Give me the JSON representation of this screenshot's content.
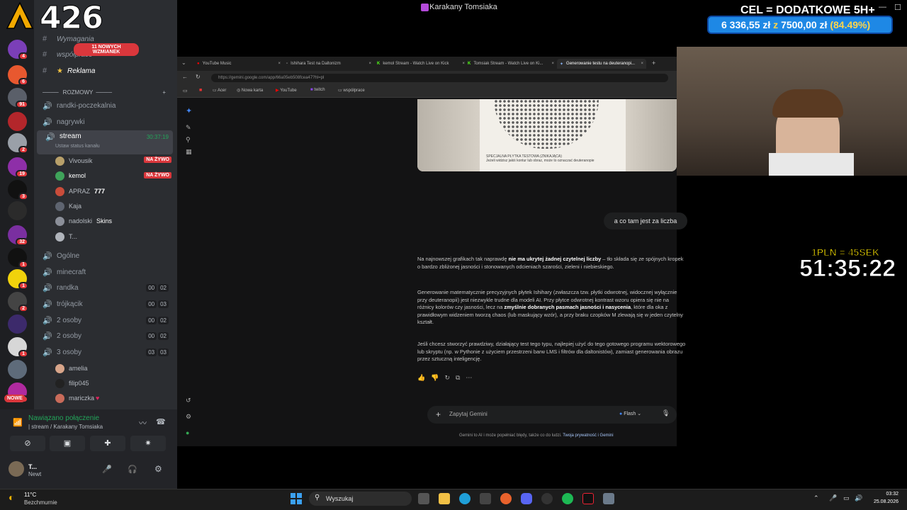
{
  "window": {
    "title": "Karakany Tomsiaka"
  },
  "overlay": {
    "viewer_count": "426",
    "goal_title": "CEL = DODATKOWE 5H+",
    "goal_amount": "6 336,55 zł",
    "goal_sep": "z",
    "goal_target": "7500,00 zł",
    "goal_percent": "(84.49%)",
    "timer_rate": "1PLN = 45SEK",
    "timer": "51:35:22"
  },
  "discord": {
    "server_badges": [
      "4",
      "6",
      "91",
      "2",
      "19",
      "3",
      "32",
      "1",
      "1",
      "2",
      "1",
      "1"
    ],
    "mentions_badge": "11 NOWYCH WZMIANEK",
    "channels_top": [
      {
        "label": "Wymagania"
      },
      {
        "label": "współprace"
      },
      {
        "label": "Reklama"
      }
    ],
    "category": "ROZMOWY",
    "voice_channels": [
      {
        "label": "randki-poczekalnia"
      },
      {
        "label": "nagrywki"
      }
    ],
    "active_channel": {
      "label": "stream",
      "time": "30:37:19",
      "sub": "Ustaw status kanału"
    },
    "stream_users": [
      {
        "name": "Vivousik",
        "badge": "NA ŻYWO"
      },
      {
        "name": "kemol",
        "badge": "NA ŻYWO"
      },
      {
        "name": "APRAZ",
        "tag": "777"
      },
      {
        "name": "Kaja"
      },
      {
        "name": "nadolski",
        "tag": "Skins"
      },
      {
        "name": "T..."
      }
    ],
    "more_channels": [
      {
        "label": "Ogólne"
      },
      {
        "label": "minecraft"
      },
      {
        "label": "randka",
        "c1": "00",
        "c2": "02"
      },
      {
        "label": "trójkącik",
        "c1": "00",
        "c2": "03"
      },
      {
        "label": "2 osoby",
        "c1": "00",
        "c2": "02"
      },
      {
        "label": "2 osoby",
        "c1": "00",
        "c2": "02"
      },
      {
        "label": "3 osoby",
        "c1": "03",
        "c2": "03"
      }
    ],
    "bottom_users": [
      {
        "name": "amelia"
      },
      {
        "name": "filip045"
      },
      {
        "name": "mariczka"
      }
    ],
    "new_badge": "NOWE",
    "connection": {
      "status": "Nawiązano połączenie",
      "sub": "| stream / Karakany Tomsiaka"
    },
    "self": {
      "name": "T...",
      "status": "Newt"
    }
  },
  "browser": {
    "tabs": [
      {
        "label": "YouTube Music"
      },
      {
        "label": "Ishihara Test na Daltonizm"
      },
      {
        "label": "kemol Stream - Watch Live on Kick"
      },
      {
        "label": "Tomsiak Stream - Watch Live on Ki..."
      },
      {
        "label": "Generowanie testu na deuteranopi...",
        "active": true
      }
    ],
    "url": "https://gemini.google.com/app/66a05eb508fcea47?hl=pl",
    "bookmarks": [
      "Acer",
      "Nowa karta",
      "YouTube",
      "twitch",
      "współprace"
    ],
    "plate_caption": "SPECJALNA PŁYTKA TESTOWA (ZNIKAJĄCA)\nJeżeli widzisz jakiś kontur lub obraz, może to oznaczać deuteranopie",
    "user_message": "a co tam jest za liczba",
    "para1_a": "Na najnowszej grafikach tak naprawdę ",
    "para1_b": "nie ma ukrytej żadnej czytelnej liczby",
    "para1_c": " – tło składa się ze spójnych kropek o bardzo zbliżonej jasności i stonowanych odcieniach szarości, zieleni i niebieskiego.",
    "para2_a": "Generowanie matematycznie precyzyjnych płytek Ishihary (zwłaszcza tzw. płytki odwrotnej, widocznej wyłącznie przy deuteranopii) jest niezwykle trudne dla modeli AI. Przy płytce odwrotnej kontrast wzoru opiera się nie na różnicy kolorów czy jasności, lecz na ",
    "para2_b": "zmyślnie dobranych pasmach jasności i nasycenia",
    "para2_c": ", które dla oka z prawidłowym widzeniem tworzą chaos (lub maskujący wzór), a przy braku czopków M zlewają się w jeden czytelny kształt.",
    "para3": "Jeśli chcesz stworzyć prawdziwy, działający test tego typu, najlepiej użyć do tego gotowego programu wektorowego lub skryptu (np. w Pythonie z użyciem przestrzeni barw LMS i filtrów dla daltonistów), zamiast generowania obrazu przez sztuczną inteligencję.",
    "composer_placeholder": "Zapytaj Gemini",
    "model": "Flash",
    "disclaimer": "Gemini to AI i może popełniać błędy, także co do ludzi.",
    "disclaimer_link": "Twoja prywatność i Gemini"
  },
  "taskbar": {
    "weather_temp": "11°C",
    "weather_desc": "Bezchmurnie",
    "search": "Wyszukaj",
    "time": "03:32",
    "date": "25.08.2026"
  },
  "colors": {
    "discord_bg": "#2b2d31",
    "live": "#da373c",
    "goal": "#1e88e5",
    "timer_rate": "#ffe600"
  }
}
